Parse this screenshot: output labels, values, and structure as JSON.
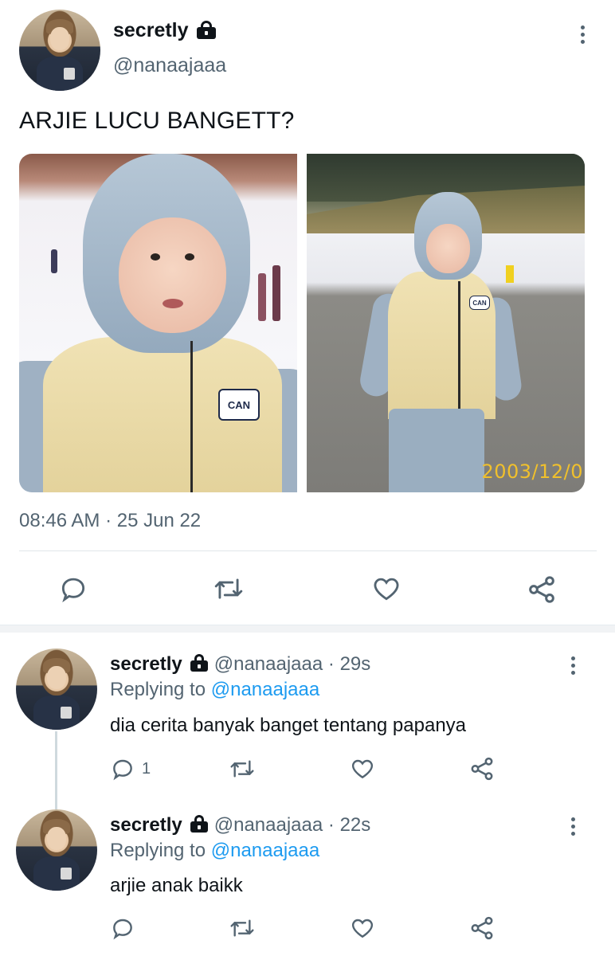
{
  "main_tweet": {
    "display_name": "secretly",
    "handle": "@nanaajaaa",
    "text": "ARJIE LUCU BANGETT?",
    "timestamp": "08:46 AM · 25 Jun 22",
    "media": {
      "left_photo": {
        "patch": "CAN"
      },
      "right_photo": {
        "patch": "CAN",
        "date_stamp": "2003/12/0"
      }
    },
    "actions": {
      "reply_icon": "reply-icon",
      "retweet_icon": "retweet-icon",
      "like_icon": "heart-icon",
      "share_icon": "share-icon"
    }
  },
  "replies": [
    {
      "display_name": "secretly",
      "handle": "@nanaajaaa",
      "time": "· 29s",
      "replying_prefix": "Replying to",
      "replying_to": "@nanaajaaa",
      "text": "dia cerita banyak banget tentang papanya",
      "reply_count": "1"
    },
    {
      "display_name": "secretly",
      "handle": "@nanaajaaa",
      "time": "· 22s",
      "replying_prefix": "Replying to",
      "replying_to": "@nanaajaaa",
      "text": "arjie anak baikk",
      "reply_count": ""
    }
  ],
  "colors": {
    "text": "#0f1419",
    "secondary": "#536471",
    "link": "#1d9bf0",
    "divider": "#e1e6ea"
  }
}
